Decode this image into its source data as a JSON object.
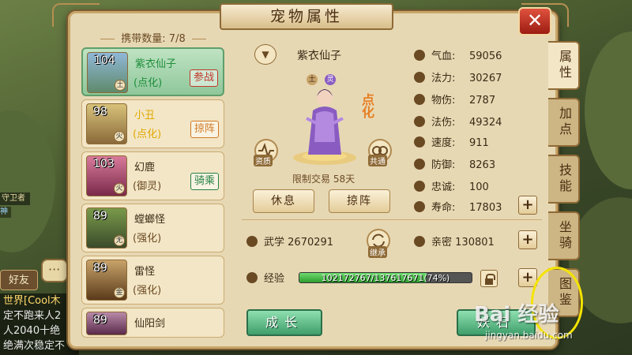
{
  "title": "宠物属性",
  "close_label": "✕",
  "carry": {
    "label": "携带数量:",
    "value": "7/8"
  },
  "pets": [
    {
      "level": "104",
      "tag": "土",
      "name": "紫衣仙子",
      "enh": "(点化)",
      "badge": "参战",
      "name_color": "#1e8f3c",
      "enh_color": "#1e8f3c",
      "badge_type": "red"
    },
    {
      "level": "98",
      "tag": "火",
      "name": "小丑",
      "enh": "(点化)",
      "badge": "掠阵",
      "name_color": "#e0a800",
      "enh_color": "#e0a800",
      "badge_type": "org"
    },
    {
      "level": "103",
      "tag": "火",
      "name": "幻鹿",
      "enh": "(御灵)",
      "badge": "骑乘",
      "name_color": "#3a2a15",
      "enh_color": "#6a4a23",
      "badge_type": "grn"
    },
    {
      "level": "89",
      "tag": "无",
      "name": "螳螂怪",
      "enh": "(强化)",
      "badge": "",
      "name_color": "#3a2a15",
      "enh_color": "#6a4a23",
      "badge_type": ""
    },
    {
      "level": "89",
      "tag": "金",
      "name": "雷怪",
      "enh": "(强化)",
      "badge": "",
      "name_color": "#3a2a15",
      "enh_color": "#6a4a23",
      "badge_type": ""
    },
    {
      "level": "89",
      "tag": "",
      "name": "仙阳剑",
      "enh": "",
      "badge": "",
      "name_color": "#3a2a15",
      "enh_color": "#6a4a23",
      "badge_type": ""
    }
  ],
  "selected_pet": {
    "name": "紫衣仙子",
    "elements": [
      "土",
      "灵"
    ],
    "dianhua": "点化",
    "trade_limit": "限制交易 58天",
    "left_circle": "资质",
    "right_circle": "共通"
  },
  "buttons": {
    "rest": "休息",
    "assist": "掠阵",
    "grow": "成长",
    "demon": "妖石",
    "inherit": "继承"
  },
  "stats": [
    {
      "label": "气血:",
      "value": "59056",
      "plus": false
    },
    {
      "label": "法力:",
      "value": "30267",
      "plus": false
    },
    {
      "label": "物伤:",
      "value": "2787",
      "plus": false
    },
    {
      "label": "法伤:",
      "value": "49324",
      "plus": false
    },
    {
      "label": "速度:",
      "value": "911",
      "plus": false
    },
    {
      "label": "防御:",
      "value": "8263",
      "plus": false
    },
    {
      "label": "忠诚:",
      "value": "100",
      "plus": false
    },
    {
      "label": "寿命:",
      "value": "17803",
      "plus": true
    }
  ],
  "martial": {
    "label": "武学",
    "value": "2670291"
  },
  "intimacy": {
    "label": "亲密",
    "value": "130801"
  },
  "exp": {
    "label": "经验",
    "text": "102172767/137617671(74%)",
    "percent": 74
  },
  "tabs": [
    "属性",
    "加点",
    "技能",
    "坐骑",
    "图鉴"
  ],
  "left_ui": {
    "guard_text": "守卫者",
    "guard_sub": "神",
    "friend_label": "好友",
    "chat_lines": [
      "世界[Cool木",
      "定不跑来人2",
      "人2040十绝",
      "绝满次稳定不"
    ]
  },
  "watermark": {
    "logo": "Bai 经验",
    "url": "jingyan.baidu.com"
  },
  "colors": {
    "accent_green": "#3e9e6a",
    "panel_bg": "#e7d8b4",
    "close_red": "#c0392b"
  }
}
